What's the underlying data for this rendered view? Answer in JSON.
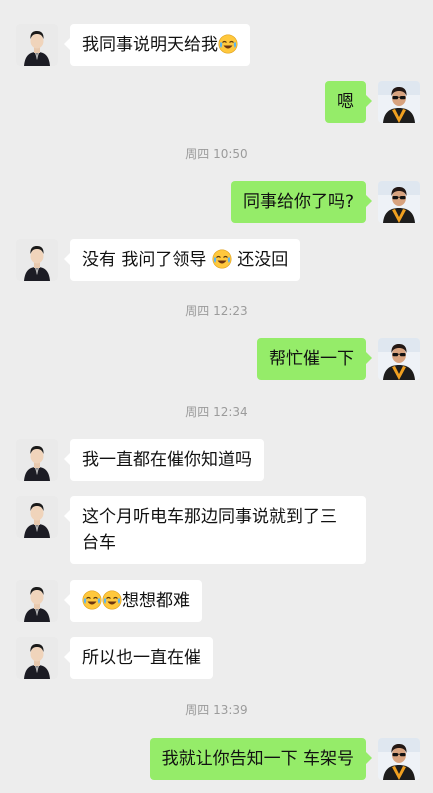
{
  "messages": [
    {
      "side": "in",
      "parts": [
        "我同事说明天给我"
      ],
      "emoji_after": true
    },
    {
      "side": "out",
      "text": "嗯"
    },
    {
      "ts": "周四 10:50"
    },
    {
      "side": "out",
      "text": "同事给你了吗?"
    },
    {
      "side": "in",
      "text_a": "没有 我问了领导",
      "text_b": "还没回"
    },
    {
      "ts": "周四 12:23"
    },
    {
      "side": "out",
      "text": "帮忙催一下"
    },
    {
      "ts": "周四 12:34"
    },
    {
      "side": "in",
      "text": "我一直都在催你知道吗"
    },
    {
      "side": "in",
      "line1": "这个月听电车那边同事说就到了三",
      "line2": "台车"
    },
    {
      "side": "in",
      "text": "想想都难",
      "emoji_count": 2
    },
    {
      "side": "in",
      "text": "所以也一直在催"
    },
    {
      "ts": "周四 13:39"
    },
    {
      "side": "out",
      "text": "我就让你告知一下 车架号"
    }
  ],
  "icons": {
    "emoji": "laughing-crying-emoji-icon",
    "avatar_left": "man-in-suit-avatar",
    "avatar_right": "man-with-sunglasses-avatar"
  },
  "colors": {
    "background": "#ededed",
    "incoming_bubble": "#ffffff",
    "outgoing_bubble": "#95ec69",
    "timestamp": "#9b9b9b"
  }
}
